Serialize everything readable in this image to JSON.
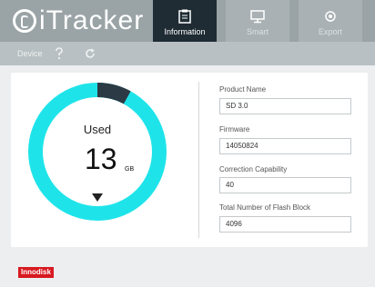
{
  "app": {
    "logo_text": "iTracker"
  },
  "tabs": [
    {
      "label": "Information",
      "icon": "clipboard-icon",
      "active": true
    },
    {
      "label": "Smart",
      "icon": "monitor-icon",
      "active": false
    },
    {
      "label": "Export",
      "icon": "gear-icon",
      "active": false
    }
  ],
  "toolbar": {
    "device_label": "Device",
    "question_icon": "help-icon",
    "refresh_icon": "refresh-icon"
  },
  "usage": {
    "label": "Used",
    "value": "13",
    "unit": "GB",
    "used_fraction": 0.92,
    "ring_color": "#1ee4ea",
    "segment_color": "#2c3a45"
  },
  "fields": [
    {
      "label": "Product Name",
      "value": "SD 3.0"
    },
    {
      "label": "Firmware",
      "value": "14050824"
    },
    {
      "label": "Correction Capability",
      "value": "40"
    },
    {
      "label": "Total Number of Flash Block",
      "value": "4096"
    }
  ],
  "footer": {
    "brand": "Innodisk",
    "brand_color": "#d71920"
  }
}
